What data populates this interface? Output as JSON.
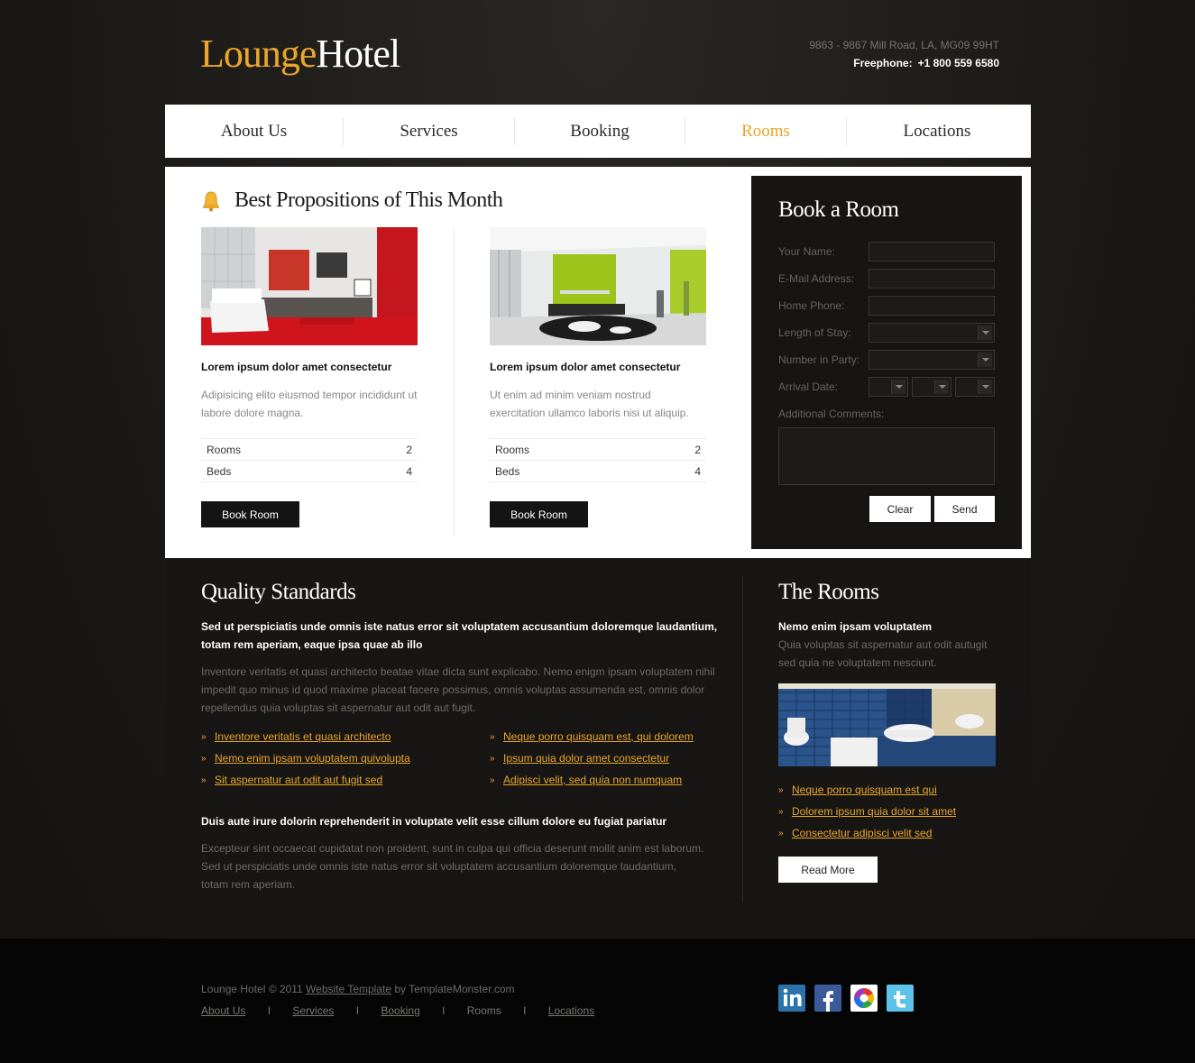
{
  "header": {
    "logo_part1": "Lounge",
    "logo_part2": "Hotel",
    "address": "9863 - 9867 Mill Road, LA, MG09 99HT",
    "freephone_label": "Freephone:",
    "freephone_number": "+1 800 559 6580"
  },
  "nav": {
    "items": [
      {
        "label": "About Us"
      },
      {
        "label": "Services"
      },
      {
        "label": "Booking"
      },
      {
        "label": "Rooms"
      },
      {
        "label": "Locations"
      }
    ],
    "active": "Rooms"
  },
  "propositions": {
    "title": "Best Propositions of This Month",
    "items": [
      {
        "title": "Lorem ipsum dolor amet consectetur",
        "desc": "Adipisicing elito eiusmod tempor incididunt ut labore dolore magna.",
        "rooms_label": "Rooms",
        "rooms_value": "2",
        "beds_label": "Beds",
        "beds_value": "4",
        "button": "Book Room"
      },
      {
        "title": "Lorem ipsum dolor amet consectetur",
        "desc": "Ut enim ad minim veniam nostrud exercitation ullamco laboris nisi ut aliquip.",
        "rooms_label": "Rooms",
        "rooms_value": "2",
        "beds_label": "Beds",
        "beds_value": "4",
        "button": "Book Room"
      }
    ]
  },
  "booking": {
    "title": "Book a Room",
    "name_label": "Your Name:",
    "email_label": "E-Mail Address:",
    "phone_label": "Home Phone:",
    "stay_label": "Length of Stay:",
    "party_label": "Number in Party:",
    "arrival_label": "Arrival Date:",
    "comments_label": "Additional Comments:",
    "clear": "Clear",
    "send": "Send"
  },
  "quality": {
    "title": "Quality Standards",
    "intro": "Sed ut perspiciatis unde omnis iste natus error sit voluptatem accusantium doloremque laudantium, totam rem aperiam, eaque ipsa quae ab illo",
    "text1": "Inventore veritatis et quasi architecto beatae vitae dicta sunt explicabo. Nemo enigm ipsam voluptatem nihil impedit quo minus id quod maxime placeat facere possimus, omnis voluptas assumenda est, omnis dolor repellendus quia voluptas sit aspernatur aut odit aut fugit.",
    "links_left": [
      "Inventore veritatis et quasi architecto",
      "Nemo enim ipsam voluptatem quivolupta",
      "Sit aspernatur aut odit aut fugit sed"
    ],
    "links_right": [
      "Neque porro quisquam est, qui dolorem",
      "Ipsum quia dolor amet consectetur",
      "Adipisci velit, sed quia non numquam"
    ],
    "subtitle": "Duis aute irure dolorin reprehenderit in voluptate velit esse cillum dolore eu fugiat pariatur",
    "text2": "Excepteur sint occaecat cupidatat non proident, sunt in culpa qui officia deserunt mollit anim est laborum. Sed ut perspiciatis unde omnis iste natus error sit voluptatem accusantium doloremque laudantium, totam rem aperiam."
  },
  "rooms": {
    "title": "The Rooms",
    "subtitle": "Nemo enim ipsam voluptatem",
    "text": "Quia voluptas sit aspernatur aut odit autugit sed quia ne voluptatem nesciunt.",
    "links": [
      "Neque porro quisquam est qui",
      "Dolorem ipsum quia dolor sit amet",
      "Consectetur adipisci velit sed"
    ],
    "button": "Read More"
  },
  "footer": {
    "copy_prefix": "Lounge Hotel © 2011 ",
    "copy_link": "Website Template",
    "copy_suffix": " by TemplateMonster.com",
    "nav": [
      "About Us",
      "Services",
      "Booking",
      "Rooms",
      "Locations"
    ],
    "separator": "I",
    "social": [
      "linkedin-icon",
      "facebook-icon",
      "picasa-icon",
      "twitter-icon"
    ]
  },
  "colors": {
    "accent": "#e9a62a",
    "dark_bg": "#171615",
    "white": "#ffffff"
  }
}
